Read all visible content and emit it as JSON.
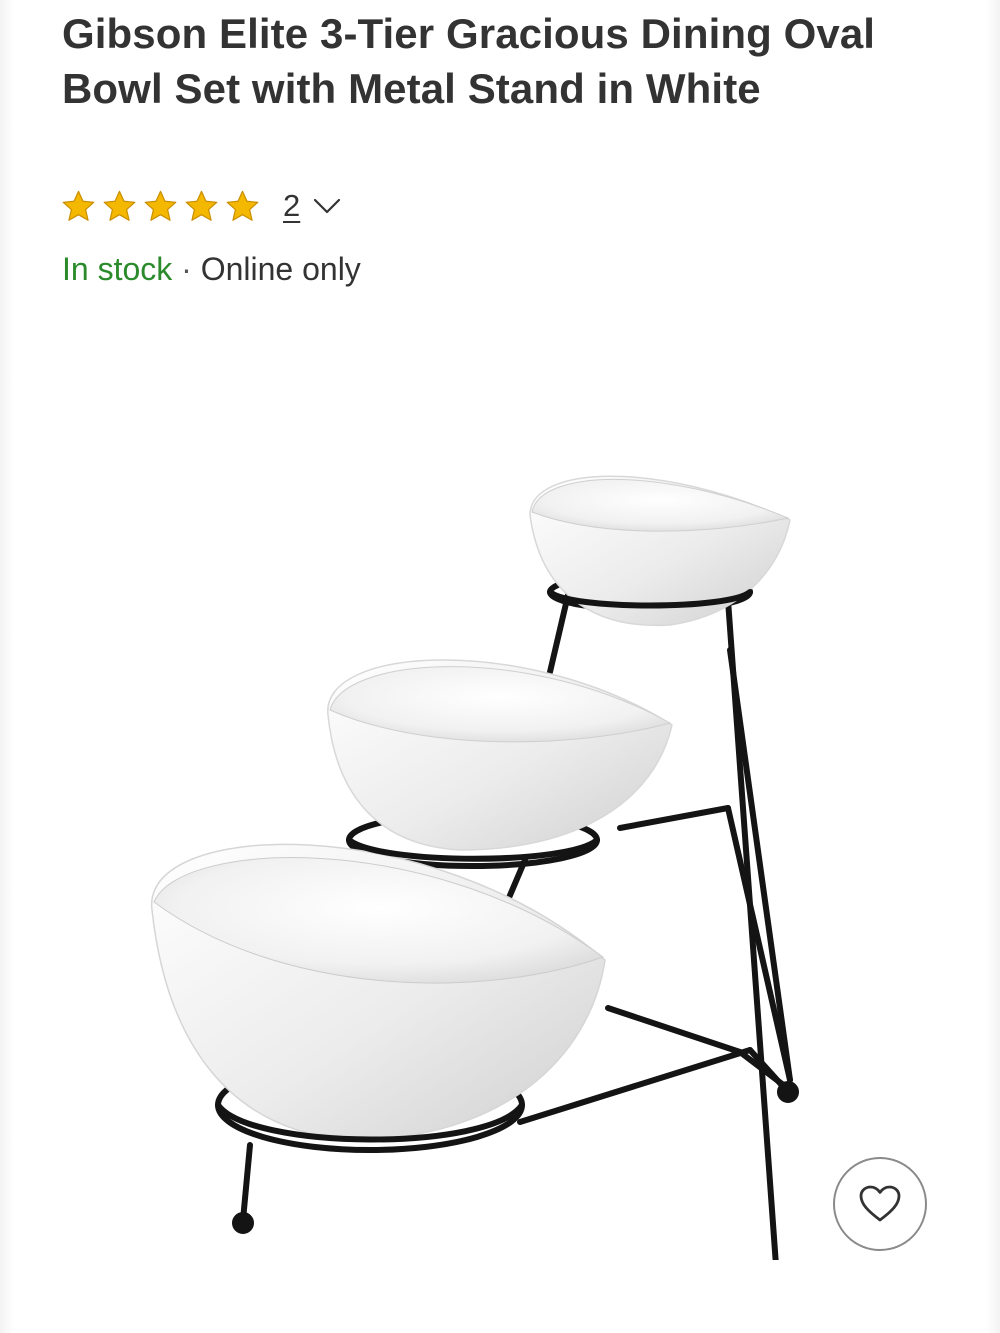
{
  "product": {
    "title": "Gibson Elite 3-Tier Gracious Dining Oval Bowl Set with Metal Stand in White",
    "rating": 5,
    "rating_max": 5,
    "review_count": "2",
    "availability": "In stock",
    "separator": "·",
    "channel": "Online only"
  },
  "icons": {
    "star": "star-icon",
    "chevron": "chevron-down-icon",
    "favorite": "heart-icon"
  },
  "colors": {
    "star_fill": "#f5b800",
    "in_stock": "#2b8a2b",
    "text": "#333333"
  }
}
